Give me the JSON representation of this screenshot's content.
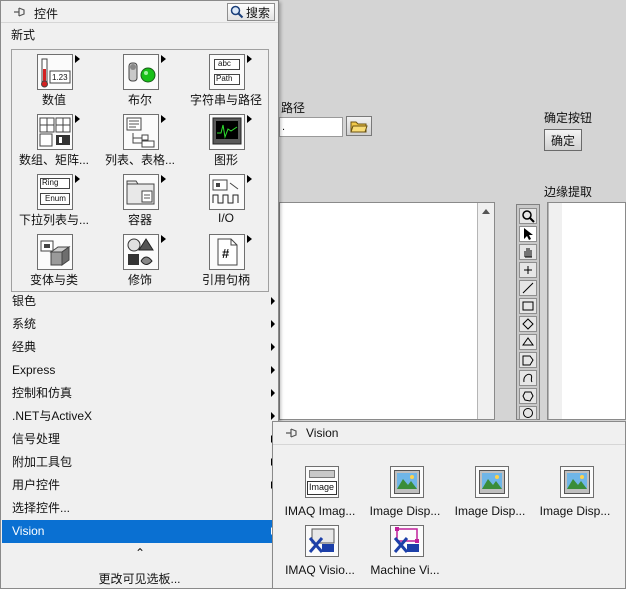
{
  "front_panel": {
    "path_label": "路径",
    "path_value": "",
    "ok_caption": "确定按钮",
    "ok_button": "确定",
    "edge_label": "边缘提取"
  },
  "palette": {
    "title": "控件",
    "search": "搜索",
    "section": "新式",
    "items": [
      {
        "label": "数值",
        "icon": "numeric-icon"
      },
      {
        "label": "布尔",
        "icon": "boolean-icon"
      },
      {
        "label": "字符串与路径",
        "icon": "string-path-icon"
      },
      {
        "label": "数组、矩阵...",
        "icon": "array-matrix-icon"
      },
      {
        "label": "列表、表格...",
        "icon": "list-table-icon"
      },
      {
        "label": "图形",
        "icon": "graph-icon"
      },
      {
        "label": "下拉列表与...",
        "icon": "ring-enum-icon"
      },
      {
        "label": "容器",
        "icon": "container-icon"
      },
      {
        "label": "I/O",
        "icon": "io-icon"
      },
      {
        "label": "变体与类",
        "icon": "variant-class-icon"
      },
      {
        "label": "修饰",
        "icon": "decorations-icon"
      },
      {
        "label": "引用句柄",
        "icon": "refnum-icon"
      }
    ],
    "icon_text": {
      "numeric": "1.23",
      "string_abc": "abc",
      "string_path": "Path",
      "ring": "Ring",
      "enum": "Enum",
      "refnum": "#"
    },
    "menu": [
      {
        "label": "银色",
        "submenu": true
      },
      {
        "label": "系统",
        "submenu": true
      },
      {
        "label": "经典",
        "submenu": true
      },
      {
        "label": "Express",
        "submenu": true
      },
      {
        "label": "控制和仿真",
        "submenu": true
      },
      {
        "label": ".NET与ActiveX",
        "submenu": true
      },
      {
        "label": "信号处理",
        "submenu": true
      },
      {
        "label": "附加工具包",
        "submenu": true
      },
      {
        "label": "用户控件",
        "submenu": true
      },
      {
        "label": "选择控件...",
        "submenu": false
      },
      {
        "label": "Vision",
        "submenu": true,
        "selected": true
      }
    ],
    "expand_symbol": "⌃",
    "change_visible": "更改可见选板..."
  },
  "vision_menu": {
    "title": "Vision",
    "image_icon_text": "Image",
    "items": [
      {
        "label": "IMAQ Imag...",
        "icon": "imaq-image-icon"
      },
      {
        "label": "Image Disp...",
        "icon": "image-display-icon"
      },
      {
        "label": "Image Disp...",
        "icon": "image-display-icon"
      },
      {
        "label": "Image Disp...",
        "icon": "image-display-icon"
      },
      {
        "label": "IMAQ Visio...",
        "icon": "imaq-vision-icon"
      },
      {
        "label": "Machine Vi...",
        "icon": "machine-vision-icon"
      }
    ]
  },
  "colors": {
    "selection": "#0a70d2",
    "palette_bg": "#f0f0f0",
    "panel_bg": "#d4d4d4"
  }
}
